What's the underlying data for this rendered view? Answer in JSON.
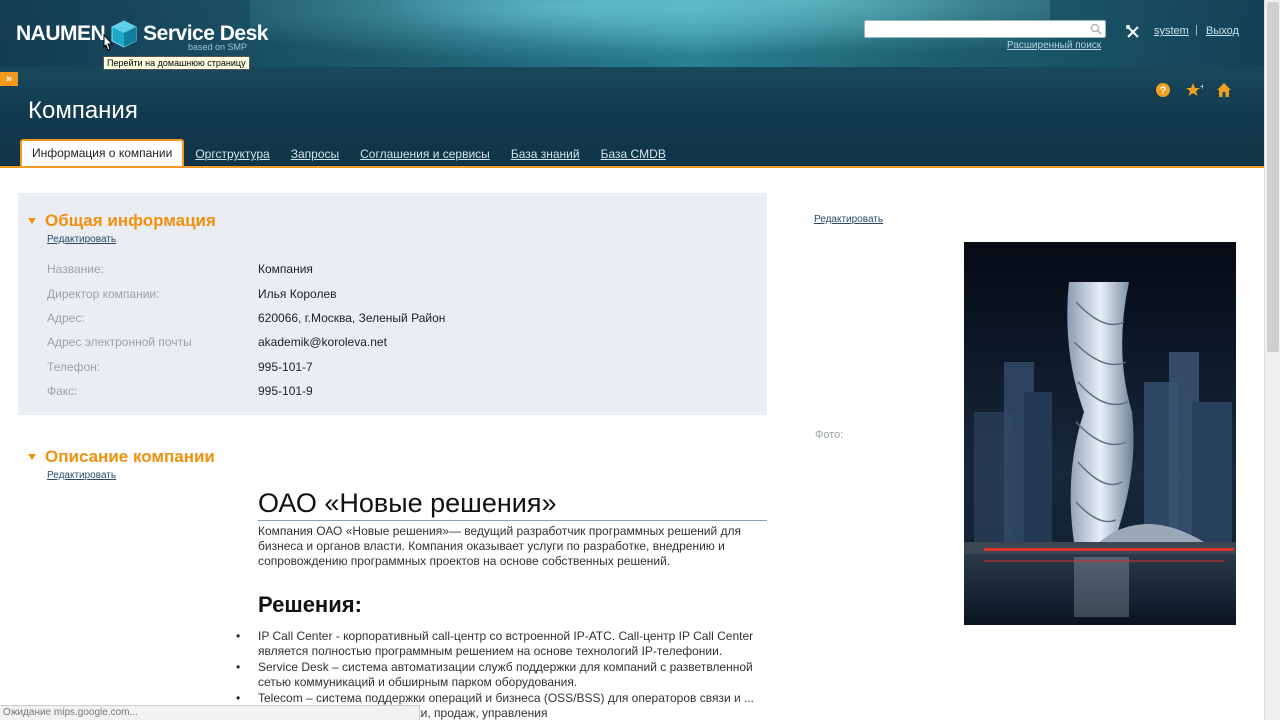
{
  "header": {
    "logo_left": "NAUMEN",
    "logo_right": "Service Desk",
    "logo_sub": "based on SMP",
    "tooltip": "Перейти на домашнюю страницу",
    "search_placeholder": "",
    "advanced_search": "Расширенный поиск",
    "user": "system",
    "separator": "|",
    "logout": "Выход",
    "collapse_handle": "»"
  },
  "page": {
    "title": "Компания",
    "tabs": [
      {
        "label": "Информация о компании",
        "active": true
      },
      {
        "label": "Оргструктура"
      },
      {
        "label": "Запросы"
      },
      {
        "label": "Соглашения и сервисы"
      },
      {
        "label": "База знаний"
      },
      {
        "label": "База CMDB"
      }
    ]
  },
  "general": {
    "title": "Общая информация",
    "edit": "Редактировать",
    "fields": [
      {
        "label": "Название:",
        "value": "Компания"
      },
      {
        "label": "Директор компании:",
        "value": "Илья Королев"
      },
      {
        "label": "Адрес:",
        "value": "620066, г.Москва, Зеленый Район"
      },
      {
        "label": "Адрес электронной почты",
        "value": "akademik@koroleva.net"
      },
      {
        "label": "Телефон:",
        "value": "995-101-7"
      },
      {
        "label": "Факс:",
        "value": "995-101-9"
      }
    ]
  },
  "description": {
    "title": "Описание компании",
    "edit": "Редактировать",
    "heading": "ОАО «Новые решения»",
    "paragraph": "Компания ОАО «Новые решения»— ведущий разработчик программных решений для бизнеса и органов власти. Компания оказывает услуги по разработке, внедрению и сопровождению программных проектов на основе собственных решений.",
    "subheading": "Решения:",
    "items": [
      "IP Call Center  - корпоративный call-центр со встроенной IP-АТС. Call-центр IP Call Center является полностью программным решением на основе технологий IP-телефонии.",
      "Service Desk – система автоматизации служб поддержки для компаний с разветвленной сетью коммуникаций и обширным парком оборудования.",
      "Telecom – система поддержки операций и бизнеса (OSS/BSS) для операторов связи и ... тизирует процессы поддержки, продаж, управления"
    ]
  },
  "photo_section": {
    "edit": "Редактировать",
    "label": "Фото:"
  },
  "status_bar": "Ожидание mips.google.com..."
}
